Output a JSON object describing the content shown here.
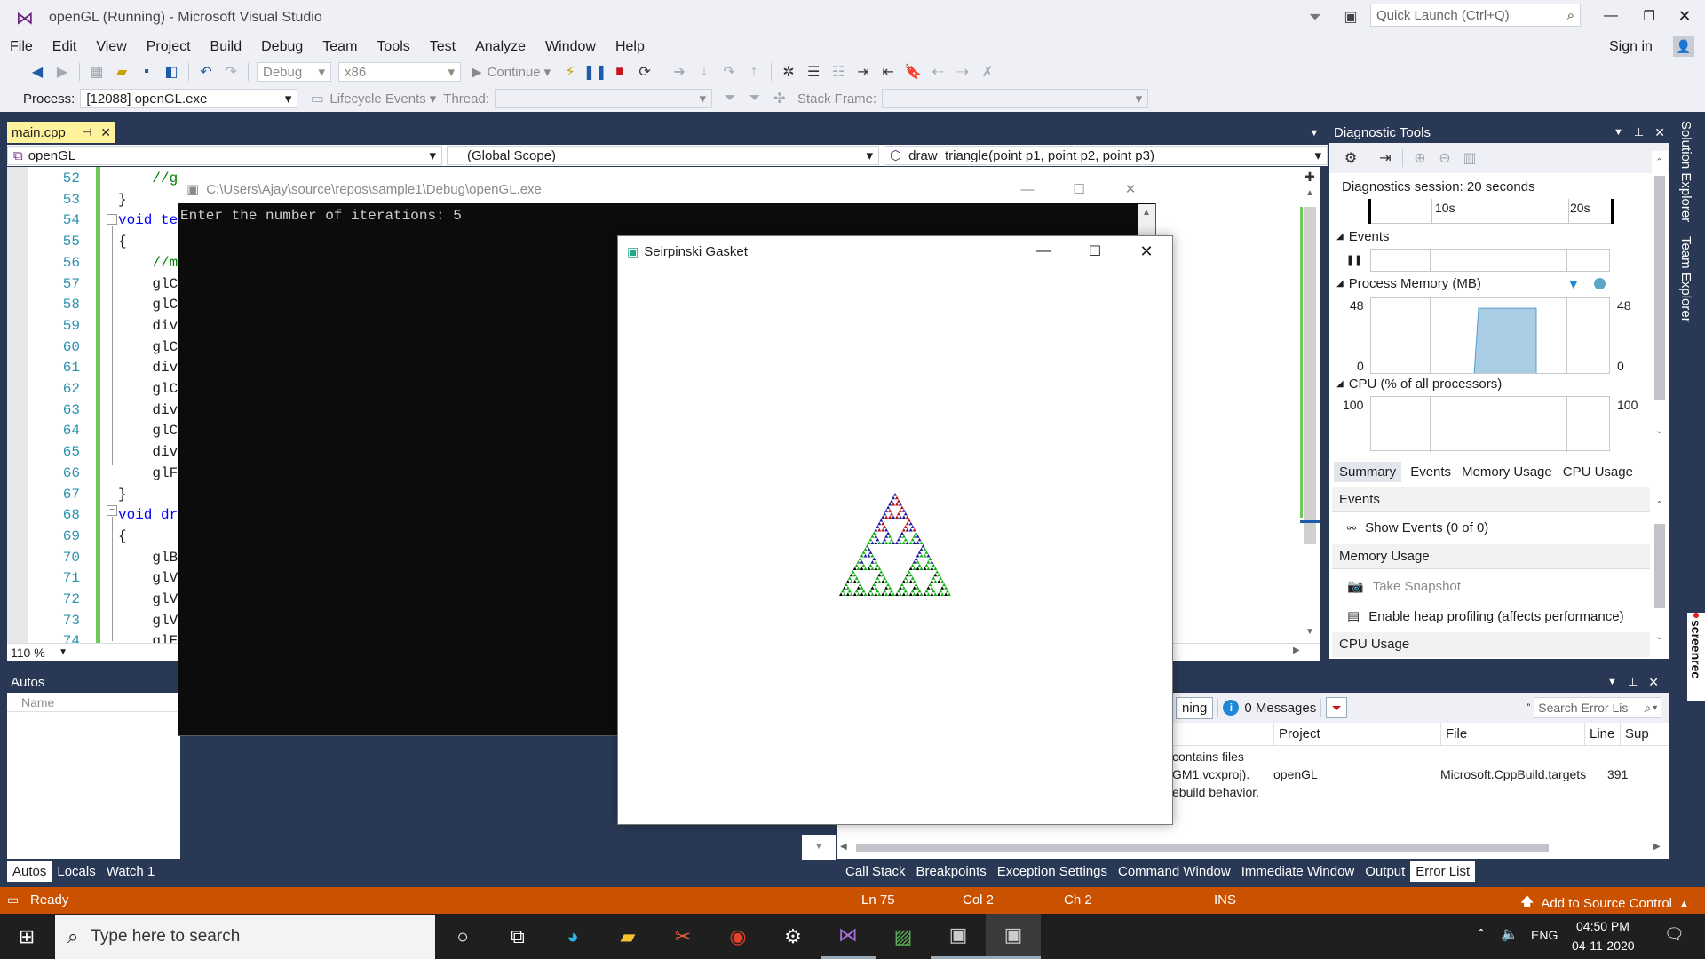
{
  "window": {
    "title": "openGL (Running) - Microsoft Visual Studio",
    "quick_launch_placeholder": "Quick Launch (Ctrl+Q)",
    "sign_in": "Sign in"
  },
  "menu": [
    "File",
    "Edit",
    "View",
    "Project",
    "Build",
    "Debug",
    "Team",
    "Tools",
    "Test",
    "Analyze",
    "Window",
    "Help"
  ],
  "toolbar": {
    "config": "Debug",
    "platform": "x86",
    "continue": "Continue",
    "process_label": "Process:",
    "process_value": "[12088] openGL.exe",
    "lifecycle": "Lifecycle Events",
    "thread_label": "Thread:",
    "stack_frame_label": "Stack Frame:"
  },
  "editor": {
    "tab": "main.cpp",
    "nav": {
      "project": "openGL",
      "scope": "(Global Scope)",
      "member": "draw_triangle(point p1, point p2, point p3)"
    },
    "lines": [
      {
        "n": "52",
        "t": "    //g"
      },
      {
        "n": "53",
        "t": "}"
      },
      {
        "n": "54",
        "t": "void te"
      },
      {
        "n": "55",
        "t": "{"
      },
      {
        "n": "56",
        "t": "    //m"
      },
      {
        "n": "57",
        "t": "    glC"
      },
      {
        "n": "58",
        "t": "    glC"
      },
      {
        "n": "59",
        "t": "    div"
      },
      {
        "n": "60",
        "t": "    glC"
      },
      {
        "n": "61",
        "t": "    div"
      },
      {
        "n": "62",
        "t": "    glC"
      },
      {
        "n": "63",
        "t": "    div"
      },
      {
        "n": "64",
        "t": "    glC"
      },
      {
        "n": "65",
        "t": "    div"
      },
      {
        "n": "66",
        "t": "    glF"
      },
      {
        "n": "67",
        "t": "}"
      },
      {
        "n": "68",
        "t": "void dr"
      },
      {
        "n": "69",
        "t": "{"
      },
      {
        "n": "70",
        "t": "    glB"
      },
      {
        "n": "71",
        "t": "    glV"
      },
      {
        "n": "72",
        "t": "    glV"
      },
      {
        "n": "73",
        "t": "    glV"
      },
      {
        "n": "74",
        "t": "    glE"
      }
    ],
    "zoom": "110 %"
  },
  "console": {
    "title": "C:\\Users\\Ajay\\source\\repos\\sample1\\Debug\\openGL.exe",
    "output": "Enter the number of iterations: 5"
  },
  "gasket": {
    "title": "Seirpinski Gasket"
  },
  "diagnostics": {
    "title": "Diagnostic Tools",
    "session": "Diagnostics session: 20 seconds",
    "t10": "10s",
    "t20": "20s",
    "events": "Events",
    "process_memory": "Process Memory (MB)",
    "mem_max": "48",
    "mem_min": "0",
    "cpu": "CPU (% of all processors)",
    "cpu_max": "100",
    "memory_fill": 0.87,
    "tabs": [
      "Summary",
      "Events",
      "Memory Usage",
      "CPU Usage"
    ],
    "summary_events": "Events",
    "show_events": "Show Events (0 of 0)",
    "memory_usage": "Memory Usage",
    "take_snapshot": "Take Snapshot",
    "heap_profiling": "Enable heap profiling (affects performance)",
    "cpu_usage": "CPU Usage"
  },
  "side_tabs": [
    "Solution Explorer",
    "Team Explorer"
  ],
  "watermark": "screenrec",
  "autos": {
    "title": "Autos",
    "col_name": "Name",
    "tabs": [
      "Autos",
      "Locals",
      "Watch 1"
    ]
  },
  "error_list": {
    "warning_btn": "ning",
    "messages": "0 Messages",
    "search_placeholder": "Search Error Lis",
    "cols": {
      "project": "Project",
      "file": "File",
      "line": "Line",
      "sup": "Sup"
    },
    "desc_lines": [
      "contains files",
      "GM1.vcxproj).",
      "ebuild behavior."
    ],
    "project": "openGL",
    "file": "Microsoft.CppBuild.targets",
    "line": "391",
    "tabs": [
      "Call Stack",
      "Breakpoints",
      "Exception Settings",
      "Command Window",
      "Immediate Window",
      "Output",
      "Error List"
    ]
  },
  "status": {
    "ready": "Ready",
    "ln": "Ln 75",
    "col": "Col 2",
    "ch": "Ch 2",
    "ins": "INS",
    "source_control": "Add to Source Control"
  },
  "taskbar": {
    "search": "Type here to search",
    "lang": "ENG",
    "time": "04:50 PM",
    "date": "04-11-2020"
  }
}
